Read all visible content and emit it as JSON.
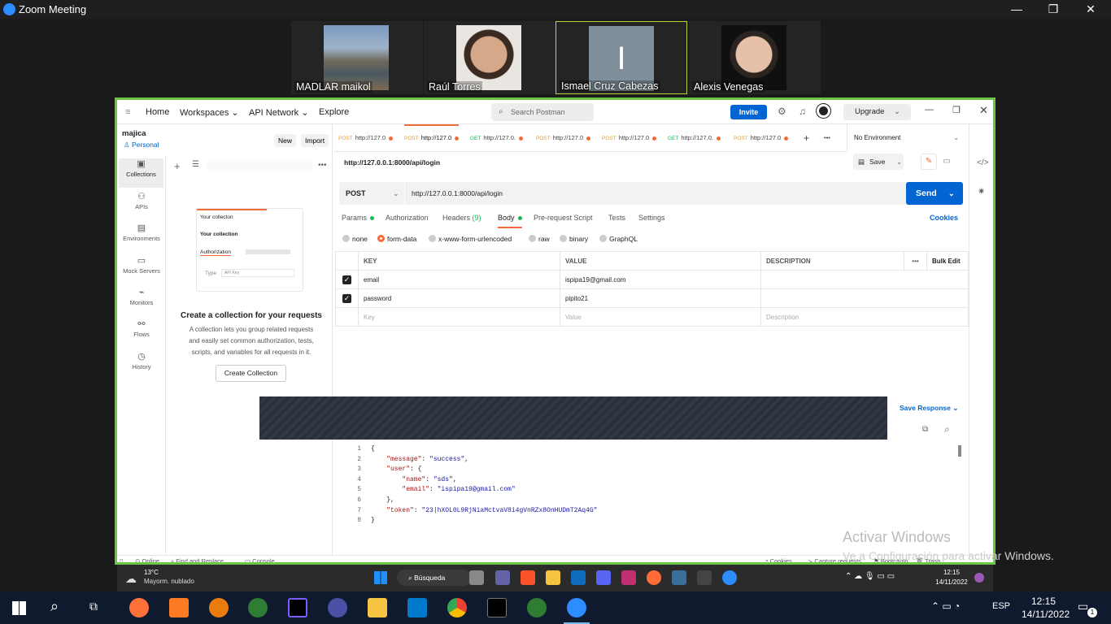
{
  "zoom": {
    "title": "Zoom Meeting",
    "minimize": "—",
    "restore": "❐",
    "close": "✕"
  },
  "participants": [
    {
      "name": "MADLAR maikol"
    },
    {
      "name": "Raúl Torres"
    },
    {
      "name": "Ismael Cruz Cabezas",
      "initial": "I"
    },
    {
      "name": "Alexis Venegas"
    }
  ],
  "postman": {
    "topnav": {
      "home": "Home",
      "workspaces": "Workspaces",
      "api_network": "API Network",
      "explore": "Explore",
      "search": "Search Postman",
      "invite": "Invite",
      "upgrade": "Upgrade"
    },
    "workspace": {
      "name": "majica",
      "type": "Personal",
      "new": "New",
      "import": "Import"
    },
    "rail": [
      "Collections",
      "APIs",
      "Environments",
      "Mock Servers",
      "Monitors",
      "Flows",
      "History"
    ],
    "empty": {
      "card_title": "Your collecton",
      "card_sub": "Your collection",
      "card_auth": "Authorization",
      "card_type": "Type",
      "card_type_val": "API Key",
      "title": "Create a collection for your requests",
      "desc1": "A collection lets you group related requests",
      "desc2": "and easily set common authorization, tests,",
      "desc3": "scripts, and variables for all requests in it.",
      "button": "Create Collection"
    },
    "tabs": [
      {
        "method": "POST",
        "label": "http://127.0"
      },
      {
        "method": "POST",
        "label": "http://127.0"
      },
      {
        "method": "GET",
        "label": "http://127.0."
      },
      {
        "method": "POST",
        "label": "http://127.0"
      },
      {
        "method": "POST",
        "label": "http://127.0"
      },
      {
        "method": "GET",
        "label": "http://127.0."
      },
      {
        "method": "POST",
        "label": "http://127.0"
      }
    ],
    "environment": "No Environment",
    "request_title": "http://127.0.0.1:8000/api/login",
    "save": "Save",
    "method": "POST",
    "url": "http://127.0.0.1:8000/api/login",
    "send": "Send",
    "subtabs": {
      "params": "Params",
      "authorization": "Authorization",
      "headers": "Headers",
      "headers_count": "(9)",
      "body": "Body",
      "prerequest": "Pre-request Script",
      "tests": "Tests",
      "settings": "Settings",
      "cookies": "Cookies"
    },
    "body_types": [
      "none",
      "form-data",
      "x-www-form-urlencoded",
      "raw",
      "binary",
      "GraphQL"
    ],
    "table": {
      "headers": {
        "key": "KEY",
        "value": "VALUE",
        "description": "DESCRIPTION",
        "bulk": "Bulk Edit"
      },
      "rows": [
        {
          "key": "email",
          "value": "ispipa19@gmail.com"
        },
        {
          "key": "password",
          "value": "pipito21"
        }
      ],
      "placeholder": {
        "key": "Key",
        "value": "Value",
        "description": "Description"
      }
    },
    "save_response": "Save Response",
    "response_lines": [
      "{",
      "    \"message\": \"success\",",
      "    \"user\": {",
      "        \"name\": \"sds\",",
      "        \"email\": \"ispipa19@gmail.com\"",
      "    },",
      "    \"token\": \"23|hXOL0L9RjNiaMctvaV8i4gVnRZx8OnHUDmT2Aq4G\"",
      "}"
    ],
    "status": {
      "online": "Online",
      "find": "Find and Replace",
      "console": "Console",
      "cookies": "Cookies",
      "capture": "Capture requests",
      "bootcamp": "Bootcamp",
      "trash": "Trash"
    }
  },
  "inner_taskbar": {
    "temp": "13°C",
    "weather": "Mayorm. nublado",
    "search": "Búsqueda",
    "time": "12:15",
    "date": "14/11/2022"
  },
  "watermark": {
    "line1": "Activar Windows",
    "line2": "Ve a Configuración para activar Windows."
  },
  "taskbar": {
    "lang": "ESP",
    "time": "12:15",
    "date": "14/11/2022",
    "notif": "1"
  }
}
